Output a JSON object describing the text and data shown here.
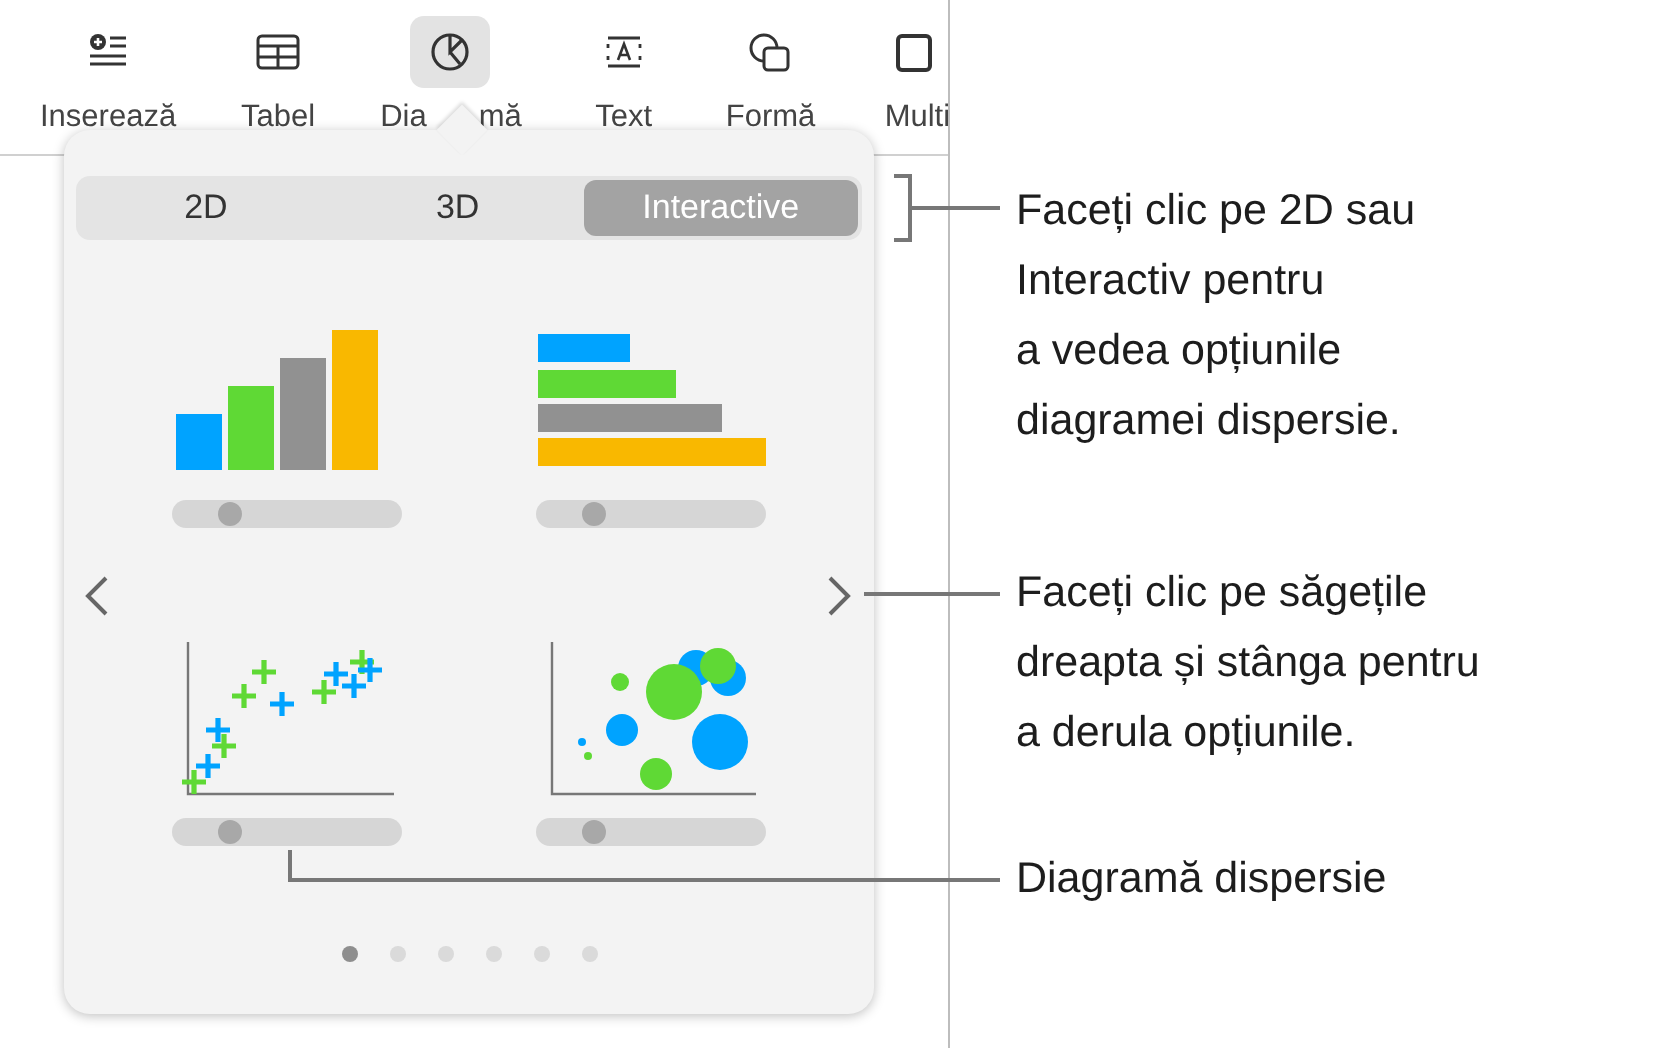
{
  "toolbar": {
    "items": [
      {
        "label": "Inserează",
        "kind": "insert",
        "selected": false
      },
      {
        "label": "Tabel",
        "kind": "table",
        "selected": false
      },
      {
        "label": "Dia",
        "label_end": "mă",
        "kind": "chart",
        "selected": true
      },
      {
        "label": "Text",
        "kind": "text",
        "selected": false
      },
      {
        "label": "Formă",
        "kind": "shape",
        "selected": false
      },
      {
        "label": "Multi",
        "kind": "media",
        "selected": false
      }
    ]
  },
  "popover": {
    "tabs": [
      {
        "label": "2D",
        "selected": false
      },
      {
        "label": "3D",
        "selected": false
      },
      {
        "label": "Interactive",
        "selected": true
      }
    ],
    "charts": [
      {
        "kind": "column",
        "level": 0.25
      },
      {
        "kind": "bar",
        "level": 0.25
      },
      {
        "kind": "scatter",
        "level": 0.25
      },
      {
        "kind": "bubble",
        "level": 0.25
      }
    ],
    "pages": [
      {
        "selected": true
      },
      {
        "selected": false
      },
      {
        "selected": false
      },
      {
        "selected": false
      },
      {
        "selected": false
      },
      {
        "selected": false
      }
    ]
  },
  "callouts": [
    {
      "text": "Faceți clic pe 2D sau\nInteractiv pentru\na vedea opțiunile\ndiagramei dispersie."
    },
    {
      "text": "Faceți clic pe săgețile\ndreapta și stânga pentru\na derula opțiunile."
    },
    {
      "text": "Diagramă dispersie"
    }
  ]
}
